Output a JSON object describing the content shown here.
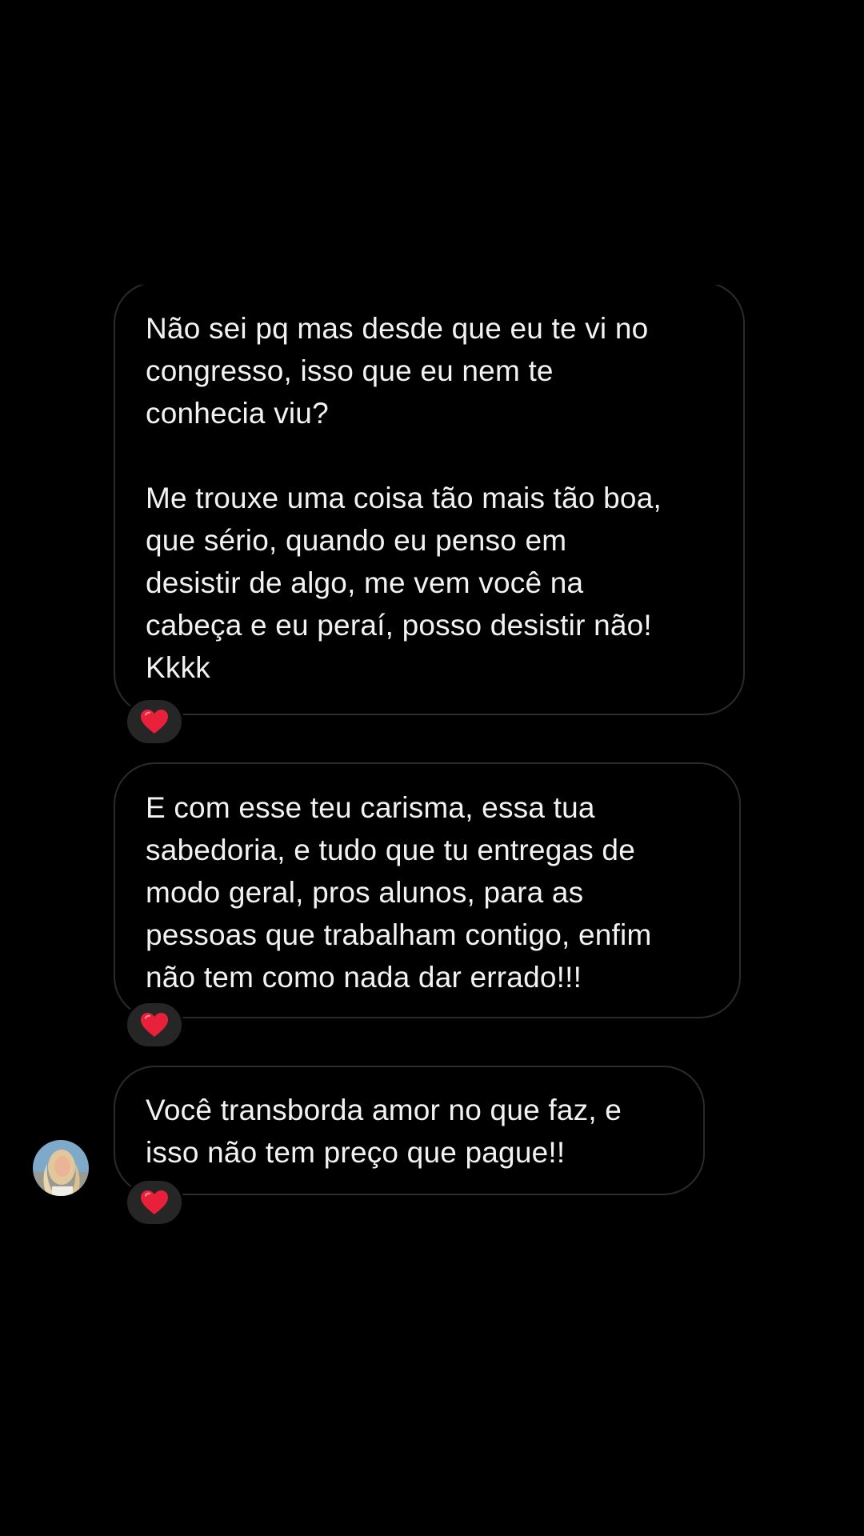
{
  "messages": [
    {
      "text": "Não sei pq mas desde que eu te vi no\ncongresso, isso que eu nem te\nconhecia viu?\n\nMe trouxe uma coisa tão mais tão boa,\nque sério, quando eu penso em\ndesistir de algo, me vem você na\ncabeça e eu peraí, posso desistir não!\nKkkk",
      "reaction": "heart-icon"
    },
    {
      "text": "E com esse teu carisma, essa tua\nsabedoria, e tudo que tu entregas de\nmodo geral, pros alunos, para as\npessoas que trabalham contigo, enfim\nnão tem como nada dar errado!!!",
      "reaction": "heart-icon"
    },
    {
      "text": "Você transborda amor no que faz, e\nisso não tem preço que pague!!",
      "reaction": "heart-icon"
    }
  ],
  "colors": {
    "background": "#000000",
    "bubble_border": "#2b2b2b",
    "reaction_bg": "#262626",
    "heart": "#e8203a"
  }
}
